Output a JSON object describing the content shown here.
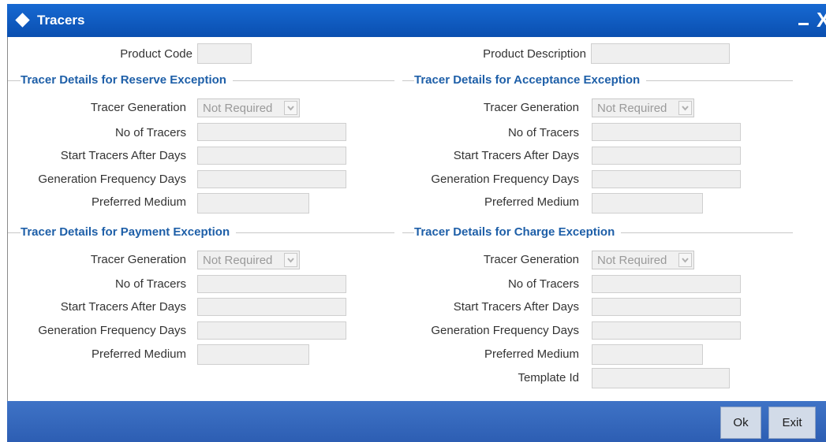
{
  "window": {
    "title": "Tracers",
    "minimize_icon": "minimize-icon",
    "close_glyph": "X"
  },
  "header": {
    "product_code_label": "Product Code",
    "product_code_value": "",
    "product_description_label": "Product Description",
    "product_description_value": ""
  },
  "sections": {
    "reserve": {
      "title": "Tracer Details for Reserve Exception",
      "tracer_generation_label": "Tracer Generation",
      "tracer_generation_value": "Not Required",
      "no_of_tracers_label": "No of Tracers",
      "start_after_days_label": "Start Tracers After Days",
      "frequency_days_label": "Generation Frequency Days",
      "preferred_medium_label": "Preferred Medium"
    },
    "acceptance": {
      "title": "Tracer Details for Acceptance Exception",
      "tracer_generation_label": "Tracer Generation",
      "tracer_generation_value": "Not Required",
      "no_of_tracers_label": "No of Tracers",
      "start_after_days_label": "Start Tracers After Days",
      "frequency_days_label": "Generation Frequency Days",
      "preferred_medium_label": "Preferred Medium"
    },
    "payment": {
      "title": "Tracer Details for Payment Exception",
      "tracer_generation_label": "Tracer Generation",
      "tracer_generation_value": "Not Required",
      "no_of_tracers_label": "No of Tracers",
      "start_after_days_label": "Start Tracers After Days",
      "frequency_days_label": "Generation Frequency Days",
      "preferred_medium_label": "Preferred Medium"
    },
    "charge": {
      "title": "Tracer Details for Charge Exception",
      "tracer_generation_label": "Tracer Generation",
      "tracer_generation_value": "Not Required",
      "no_of_tracers_label": "No of Tracers",
      "start_after_days_label": "Start Tracers After Days",
      "frequency_days_label": "Generation Frequency Days",
      "preferred_medium_label": "Preferred Medium",
      "template_id_label": "Template Id"
    }
  },
  "footer": {
    "ok_label": "Ok",
    "exit_label": "Exit"
  },
  "colors": {
    "titlebar": "#0a5bc4",
    "footer": "#3566b8",
    "section_title": "#1e5fa8"
  }
}
